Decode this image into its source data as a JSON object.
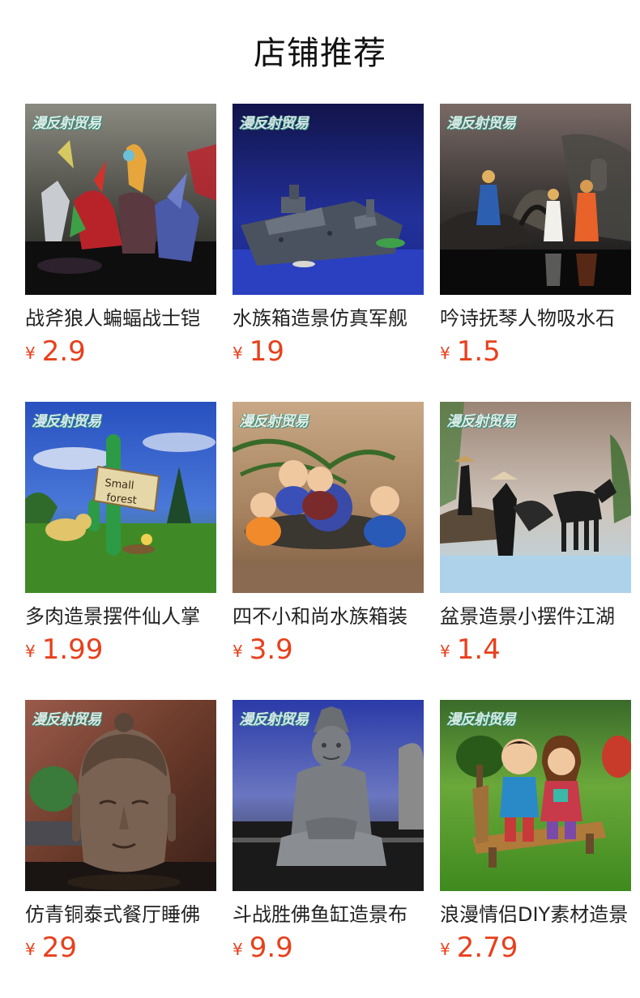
{
  "header": {
    "title": "店铺推荐"
  },
  "watermark": "漫反射贸易",
  "currency_symbol": "¥",
  "products": [
    {
      "title": "战斧狼人蝙蝠战士铠",
      "price": "2.9",
      "image_icon": "fantasy-figurines-icon"
    },
    {
      "title": "水族箱造景仿真军舰",
      "price": "19",
      "image_icon": "aquarium-warship-icon"
    },
    {
      "title": "吟诗抚琴人物吸水石",
      "price": "1.5",
      "image_icon": "scholar-figurines-icon"
    },
    {
      "title": "多肉造景摆件仙人掌",
      "price": "1.99",
      "image_icon": "cactus-sign-icon"
    },
    {
      "title": "四不小和尚水族箱装",
      "price": "3.9",
      "image_icon": "little-monks-icon"
    },
    {
      "title": "盆景造景小摆件江湖",
      "price": "1.4",
      "image_icon": "swordsman-horse-icon"
    },
    {
      "title": "仿青铜泰式餐厅睡佛",
      "price": "29",
      "image_icon": "buddha-head-icon"
    },
    {
      "title": "斗战胜佛鱼缸造景布",
      "price": "9.9",
      "image_icon": "seated-monkey-king-icon"
    },
    {
      "title": "浪漫情侣DIY素材造景",
      "price": "2.79",
      "image_icon": "couple-bench-icon"
    }
  ],
  "colors": {
    "price": "#e8401c",
    "title_text": "#222222",
    "watermark": "#e9f7f3"
  }
}
